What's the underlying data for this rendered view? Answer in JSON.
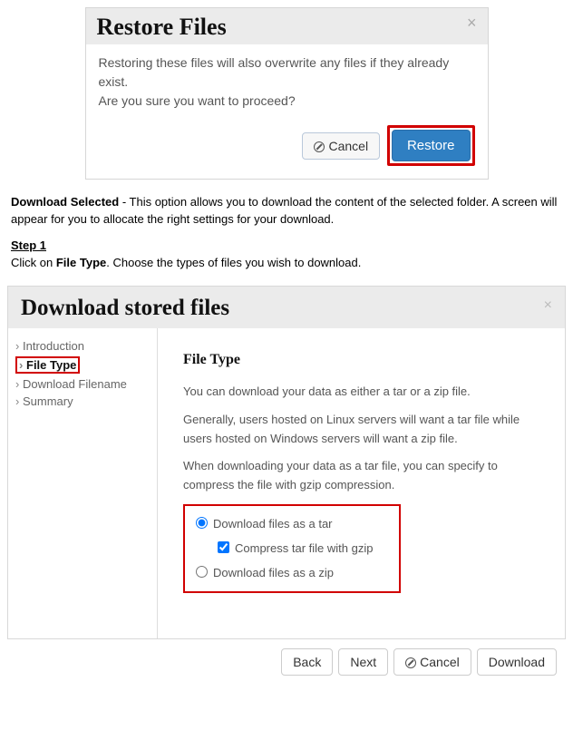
{
  "dialog1": {
    "title": "Restore Files",
    "line1": "Restoring these files will also overwrite any files if they already exist.",
    "line2": "Are you sure you want to proceed?",
    "cancel": "Cancel",
    "restore": "Restore"
  },
  "doc": {
    "download_selected_label": "Download Selected",
    "download_selected_text": " - This option allows you to download the content of the selected folder. A screen will appear for you to allocate the right settings for your download.",
    "step1_label": "Step 1",
    "step1_prefix": "Click on ",
    "step1_bold": "File Type",
    "step1_suffix": ". Choose the types of files you wish to download."
  },
  "dialog2": {
    "title": "Download stored files",
    "nav": {
      "intro": "Introduction",
      "filetype": "File Type",
      "filename": "Download Filename",
      "summary": "Summary"
    },
    "panel": {
      "heading": "File Type",
      "p1": "You can download your data as either a tar or a zip file.",
      "p2": "Generally, users hosted on Linux servers will want a tar file while users hosted on Windows servers will want a zip file.",
      "p3": "When downloading your data as a tar file, you can specify to compress the file with gzip compression.",
      "opt_tar": "Download files as a tar",
      "opt_gzip": "Compress tar file with gzip",
      "opt_zip": "Download files as a zip"
    },
    "footer": {
      "back": "Back",
      "next": "Next",
      "cancel": "Cancel",
      "download": "Download"
    }
  }
}
